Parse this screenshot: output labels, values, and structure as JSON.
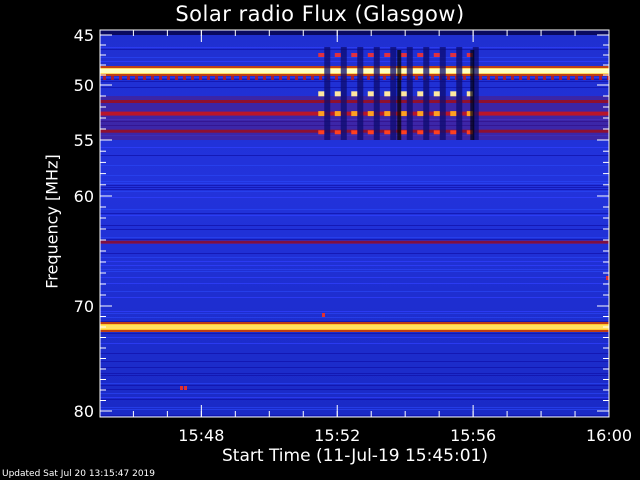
{
  "chart_data": {
    "type": "heatmap",
    "title": "Solar radio Flux (Glasgow)",
    "xlabel": "Start Time (11-Jul-19 15:45:01)",
    "ylabel": "Frequency [MHz]",
    "xlim": [
      "15:45:01",
      "16:00"
    ],
    "ylim": [
      45,
      80
    ],
    "x_ticks": [
      "15:48",
      "15:52",
      "15:56",
      "16:00"
    ],
    "y_ticks": [
      "45",
      "50",
      "55",
      "60",
      "70",
      "80"
    ],
    "y_tick_values": [
      45,
      50,
      55,
      60,
      70,
      80
    ],
    "colormap": [
      "#000010",
      "#1010d0",
      "#2a3cf0",
      "#800030",
      "#d01010",
      "#ffa000",
      "#ffffff"
    ],
    "background_color": "#1c2fd8",
    "bands": [
      {
        "freq": 48.6,
        "intensity": "saturated",
        "color": "#ffffc0"
      },
      {
        "freq": 51.5,
        "intensity": "medium",
        "color": "#a01020"
      },
      {
        "freq": 52.6,
        "intensity": "high",
        "color": "#e01818"
      },
      {
        "freq": 54.2,
        "intensity": "medium",
        "color": "#a01020"
      },
      {
        "freq": 64.2,
        "intensity": "low",
        "color": "#801040"
      },
      {
        "freq": 72.0,
        "intensity": "saturated",
        "color": "#ffe060"
      }
    ],
    "burst_region": {
      "time_start": "15:51",
      "time_end": "15:56",
      "freq_start": 46.5,
      "freq_end": 55
    }
  },
  "footer": {
    "updated": "Updated Sat Jul 20 13:15:47 2019"
  }
}
